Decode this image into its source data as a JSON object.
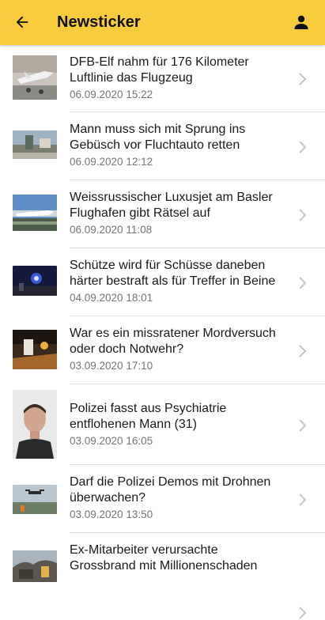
{
  "appbar": {
    "title": "Newsticker",
    "back_icon": "arrow-left-icon",
    "account_icon": "person-icon",
    "color": "#f9cc3d"
  },
  "items": [
    {
      "headline": "DFB-Elf nahm für 176 Kilometer Luftlinie das Flugzeug",
      "date": "06.09.2020 15:22"
    },
    {
      "headline": "Mann muss sich mit Sprung ins Gebüsch vor Fluchtauto retten",
      "date": "06.09.2020 12:12"
    },
    {
      "headline": "Weissrussischer Luxusjet am Basler Flughafen gibt Rätsel auf",
      "date": "06.09.2020 11:08"
    },
    {
      "headline": "Schütze wird für Schüsse daneben härter bestraft als für Treffer in Beine",
      "date": "04.09.2020 18:01"
    },
    {
      "headline": "War es ein missratener Mordversuch oder doch Notwehr?",
      "date": "03.09.2020 17:10"
    },
    {
      "headline": "Polizei fasst aus Psychiatrie entflohenen Mann (31)",
      "date": "03.09.2020 16:05"
    },
    {
      "headline": "Darf die Polizei Demos mit Drohnen überwachen?",
      "date": "03.09.2020 13:50"
    },
    {
      "headline": "Ex-Mitarbeiter verursachte Grossbrand mit Millionenschaden",
      "date": ""
    }
  ]
}
